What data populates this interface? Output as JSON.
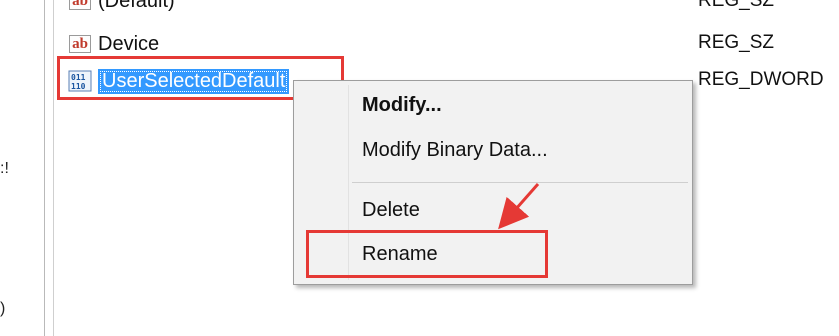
{
  "tree": {
    "fragments": [
      ":!",
      ")"
    ]
  },
  "values_list": {
    "rows": [
      {
        "name": "(Default)",
        "type": "REG_SZ",
        "icon": "string-value-icon"
      },
      {
        "name": "Device",
        "type": "REG_SZ",
        "icon": "string-value-icon"
      },
      {
        "name": "UserSelectedDefault",
        "type": "REG_DWORD",
        "icon": "binary-value-icon"
      }
    ]
  },
  "context_menu": {
    "items": [
      {
        "label": "Modify...",
        "default": true
      },
      {
        "label": "Modify Binary Data...",
        "default": false
      },
      {
        "label": "Delete",
        "default": false
      },
      {
        "label": "Rename",
        "default": false
      }
    ]
  },
  "colors": {
    "selection": "#3399ff",
    "highlight": "#e53935",
    "menu_background": "#f2f2f2"
  }
}
